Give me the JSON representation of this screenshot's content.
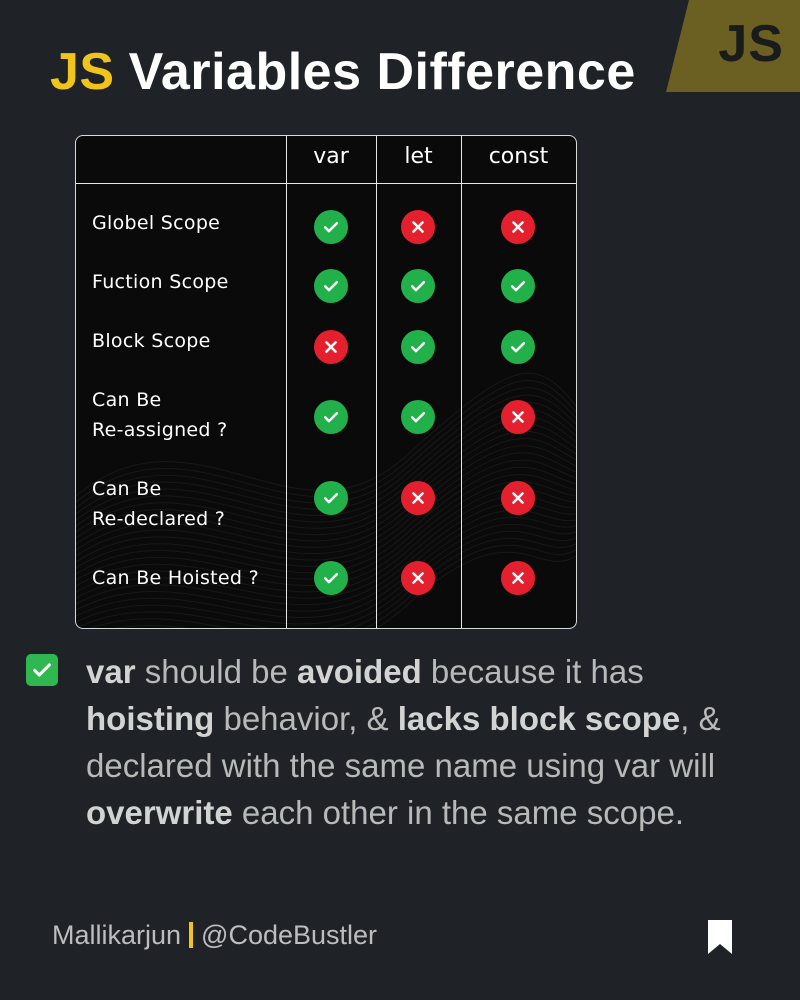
{
  "title": {
    "prefix": "JS",
    "rest": "Variables Difference"
  },
  "logo": {
    "text": "JS"
  },
  "table": {
    "headers": [
      "var",
      "let",
      "const"
    ],
    "rows": [
      {
        "label": "Globel Scope",
        "values": [
          true,
          false,
          false
        ]
      },
      {
        "label": "Fuction Scope",
        "values": [
          true,
          true,
          true
        ]
      },
      {
        "label": "Block Scope",
        "values": [
          false,
          true,
          true
        ]
      },
      {
        "label": "Can Be\nRe-assigned ?",
        "values": [
          true,
          true,
          false
        ]
      },
      {
        "label": "Can Be\nRe-declared ?",
        "values": [
          true,
          false,
          false
        ]
      },
      {
        "label": "Can Be Hoisted ?",
        "values": [
          true,
          false,
          false
        ]
      }
    ]
  },
  "colors": {
    "accent": "#f0c419",
    "check": "#22b04b",
    "cross": "#e5202e",
    "background": "#1f2227"
  },
  "tip": {
    "icon": "check-mark-button-icon",
    "segments": [
      {
        "text": "var",
        "bold": true
      },
      {
        "text": " should be ",
        "bold": false
      },
      {
        "text": "avoided",
        "bold": true
      },
      {
        "text": " because it has ",
        "bold": false
      },
      {
        "text": "hoisting",
        "bold": true
      },
      {
        "text": " behavior, & ",
        "bold": false
      },
      {
        "text": "lacks block scope",
        "bold": true
      },
      {
        "text": ", & declared with the same name using var will ",
        "bold": false
      },
      {
        "text": "overwrite",
        "bold": true
      },
      {
        "text": " each other in the same scope.",
        "bold": false
      }
    ]
  },
  "footer": {
    "author": "Mallikarjun",
    "handle": "@CodeBustler",
    "icon": "bookmark-icon"
  }
}
